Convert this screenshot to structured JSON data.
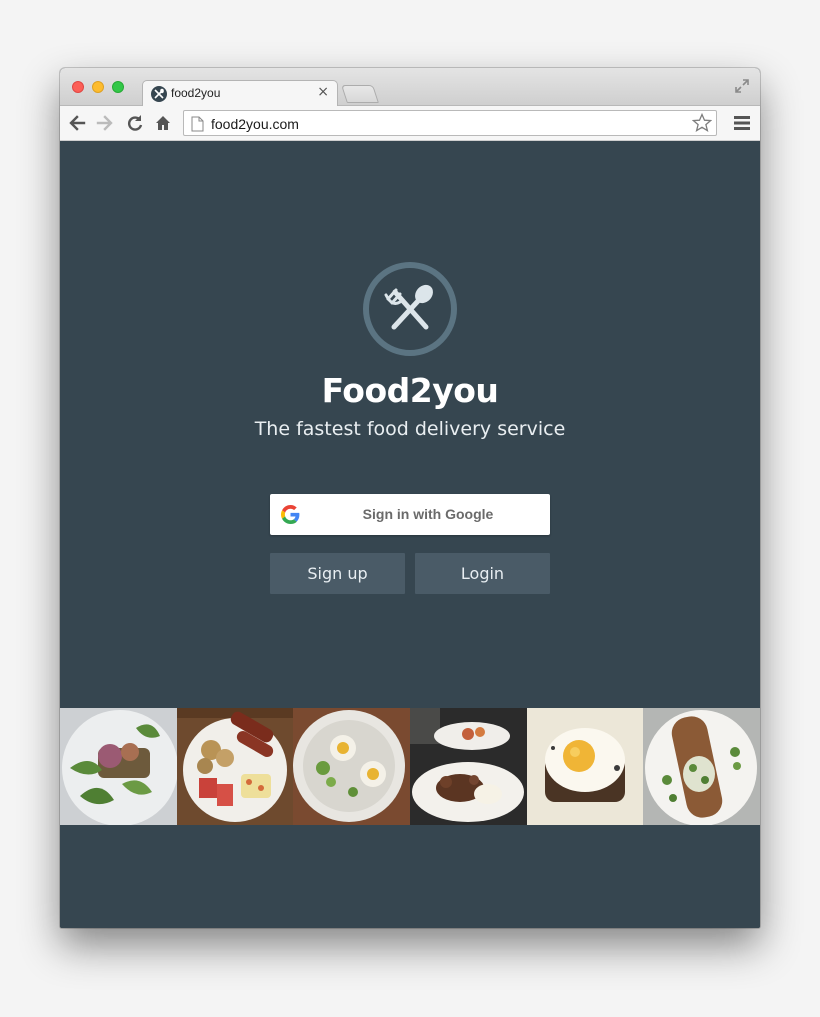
{
  "browser": {
    "tab": {
      "title": "food2you",
      "close": "×"
    },
    "address": {
      "url": "food2you.com"
    }
  },
  "page": {
    "title": "Food2you",
    "tagline": "The fastest food delivery service",
    "google_button": "Sign in with Google",
    "signup_button": "Sign up",
    "login_button": "Login"
  },
  "colors": {
    "background": "#364650",
    "button": "#4a5b67",
    "logo_ring": "#5b7482"
  }
}
